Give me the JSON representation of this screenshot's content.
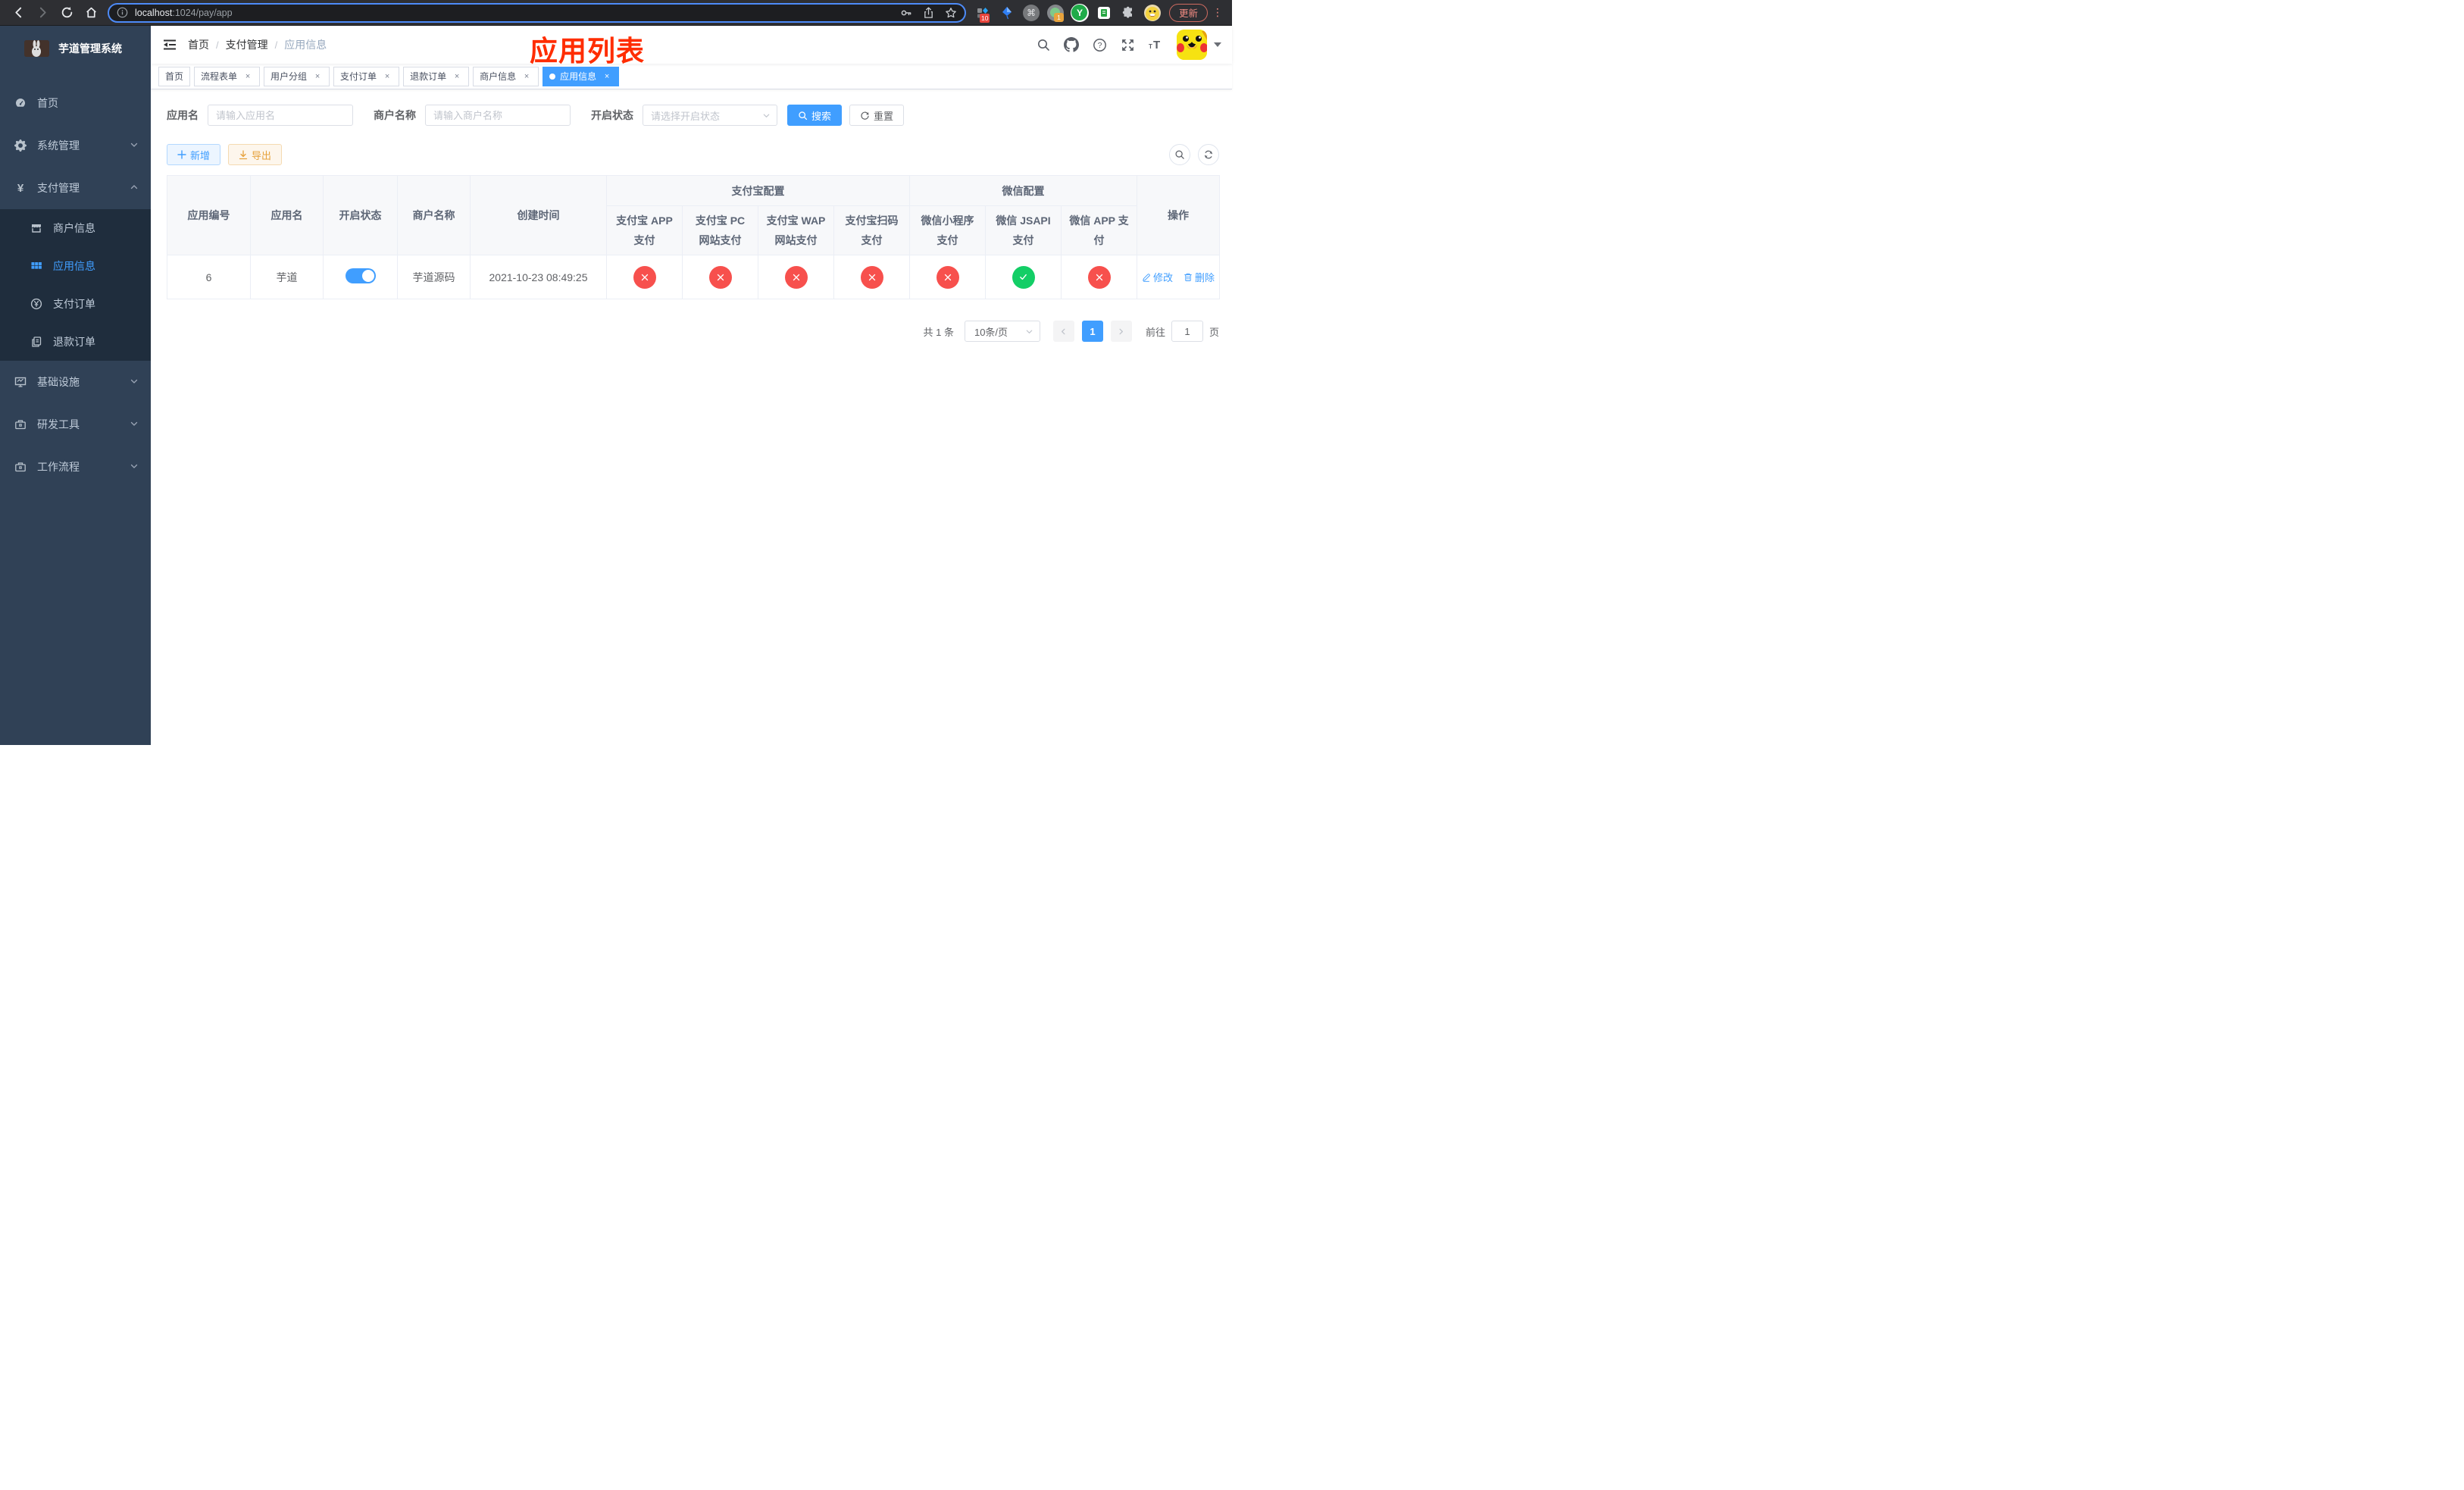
{
  "browser": {
    "url_host": "localhost",
    "url_path": ":1024/pay/app",
    "update_button": "更新",
    "ext_badge_1": "10",
    "ext_badge_2": "1",
    "ext_y": "Y",
    "command_glyph": "⌘",
    "menu_dots": "⋮"
  },
  "icons": {
    "close": "×",
    "breadcrumb_sep": "/",
    "yen": "¥"
  },
  "sidebar": {
    "title": "芋道管理系统",
    "items": {
      "home": "首页",
      "system": "系统管理",
      "payment": "支付管理",
      "merchant": "商户信息",
      "app_info": "应用信息",
      "pay_order": "支付订单",
      "refund_order": "退款订单",
      "infra": "基础设施",
      "dev_tools": "研发工具",
      "workflow": "工作流程"
    }
  },
  "breadcrumb": {
    "home": "首页",
    "section": "支付管理",
    "current": "应用信息"
  },
  "annotation": {
    "text": "应用列表",
    "color": "#ff2d00"
  },
  "tabs": [
    {
      "label": "首页",
      "closable": false,
      "active": false
    },
    {
      "label": "流程表单",
      "closable": true,
      "active": false
    },
    {
      "label": "用户分组",
      "closable": true,
      "active": false
    },
    {
      "label": "支付订单",
      "closable": true,
      "active": false
    },
    {
      "label": "退款订单",
      "closable": true,
      "active": false
    },
    {
      "label": "商户信息",
      "closable": true,
      "active": false
    },
    {
      "label": "应用信息",
      "closable": true,
      "active": true
    }
  ],
  "search": {
    "app_name_label": "应用名",
    "app_name_placeholder": "请输入应用名",
    "merchant_label": "商户名称",
    "merchant_placeholder": "请输入商户名称",
    "status_label": "开启状态",
    "status_placeholder": "请选择开启状态",
    "search_button": "搜索",
    "reset_button": "重置"
  },
  "toolbar": {
    "add_label": "新增",
    "export_label": "导出"
  },
  "table": {
    "col_id": "应用编号",
    "col_name": "应用名",
    "col_status": "开启状态",
    "col_merchant": "商户名称",
    "col_created": "创建时间",
    "group_alipay": "支付宝配置",
    "group_wechat": "微信配置",
    "col_op": "操作",
    "alipay_cols": [
      "支付宝 APP 支付",
      "支付宝 PC 网站支付",
      "支付宝 WAP 网站支付",
      "支付宝扫码支付"
    ],
    "wechat_cols": [
      "微信小程序支付",
      "微信 JSAPI 支付",
      "微信 APP 支付"
    ],
    "row": {
      "id": "6",
      "name": "芋道",
      "status_on": true,
      "merchant": "芋道源码",
      "created": "2021-10-23 08:49:25",
      "pay_channels": [
        "no",
        "no",
        "no",
        "no",
        "no",
        "yes",
        "no"
      ]
    },
    "edit_label": "修改",
    "delete_label": "删除",
    "status_colors": {
      "enabled": "#13ce66",
      "disabled": "#f7504d",
      "toggle_on": "#409eff"
    }
  },
  "pagination": {
    "total": "共 1 条",
    "per_page": "10条/页",
    "current_page": "1",
    "goto_label": "前往",
    "goto_value": "1",
    "page_unit": "页"
  }
}
